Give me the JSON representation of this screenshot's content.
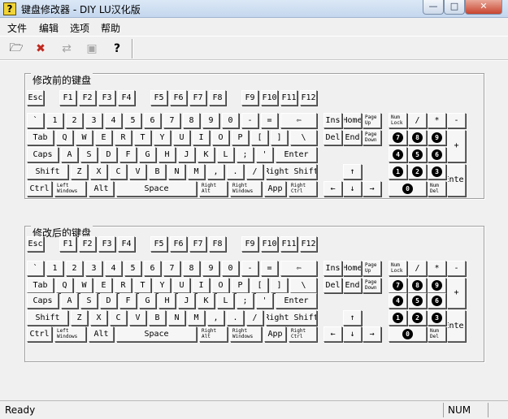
{
  "window": {
    "title": "键盘修改器 - DIY   LU汉化版",
    "icon_letter": "?"
  },
  "window_controls": {
    "minimize": "—",
    "maximize": "□",
    "close": "✕"
  },
  "menu": [
    {
      "label": "文件",
      "name": "menu-file"
    },
    {
      "label": "编辑",
      "name": "menu-edit"
    },
    {
      "label": "选项",
      "name": "menu-options"
    },
    {
      "label": "帮助",
      "name": "menu-help"
    }
  ],
  "toolbar": [
    {
      "name": "open-keyboard-button",
      "icon": "open-icon",
      "glyph": "🗁",
      "disabled": false
    },
    {
      "name": "delete-button",
      "icon": "delete-icon",
      "glyph": "✖",
      "disabled": false
    },
    {
      "name": "swap-button",
      "icon": "swap-icon",
      "glyph": "⇄",
      "disabled": true
    },
    {
      "name": "view-button",
      "icon": "view-icon",
      "glyph": "▣",
      "disabled": true
    },
    {
      "name": "help-button",
      "icon": "help-icon",
      "glyph": "?",
      "disabled": false
    }
  ],
  "groups": [
    {
      "name": "before-keyboard-group",
      "label": "修改前的键盘"
    },
    {
      "name": "after-keyboard-group",
      "label": "修改后的键盘"
    }
  ],
  "keys": {
    "esc": "Esc",
    "f1": "F1",
    "f2": "F2",
    "f3": "F3",
    "f4": "F4",
    "f5": "F5",
    "f6": "F6",
    "f7": "F7",
    "f8": "F8",
    "f9": "F9",
    "f10": "F10",
    "f11": "F11",
    "f12": "F12",
    "backtick": "`",
    "d1": "1",
    "d2": "2",
    "d3": "3",
    "d4": "4",
    "d5": "5",
    "d6": "6",
    "d7": "7",
    "d8": "8",
    "d9": "9",
    "d0": "0",
    "minus": "-",
    "equals": "=",
    "backspace": "⇦",
    "tab": "Tab",
    "q": "Q",
    "w": "W",
    "e": "E",
    "r": "R",
    "t": "T",
    "y": "Y",
    "u": "U",
    "i": "I",
    "o": "O",
    "p": "P",
    "lbracket": "[",
    "rbracket": "]",
    "backslash": "\\",
    "caps": "Caps",
    "a": "A",
    "s": "S",
    "d": "D",
    "f": "F",
    "g": "G",
    "h": "H",
    "j": "J",
    "k": "K",
    "l": "L",
    "semicolon": ";",
    "quote": "'",
    "enter": "Enter",
    "lshift": "Shift",
    "z": "Z",
    "x": "X",
    "c": "C",
    "v": "V",
    "b": "B",
    "n": "N",
    "m": "M",
    "comma": ",",
    "period": ".",
    "slash": "/",
    "rshift": "Right Shift",
    "lctrl": "Ctrl",
    "lwin": "Left\nWindows",
    "lalt": "Alt",
    "space": "Space",
    "ralt": "Right\nAlt",
    "rwin": "Right\nWindows",
    "app": "App",
    "rctrl": "Right\nCtrl",
    "ins": "Ins",
    "home": "Home",
    "pgup": "Page\nUp",
    "del": "Del",
    "end": "End",
    "pgdn": "Page\nDown",
    "up": "↑",
    "left": "←",
    "down": "↓",
    "right": "→",
    "numlock": "Num\nLock",
    "numdiv": "/",
    "nummul": "*",
    "numsub": "-",
    "num7": "7",
    "num8": "8",
    "num9": "9",
    "numadd": "+",
    "num4": "4",
    "num5": "5",
    "num6": "6",
    "num1": "1",
    "num2": "2",
    "num3": "3",
    "numenter": "Enter",
    "num0": "0",
    "numdel": "Num\nDel"
  },
  "status": {
    "text": "Ready",
    "num": "NUM"
  }
}
